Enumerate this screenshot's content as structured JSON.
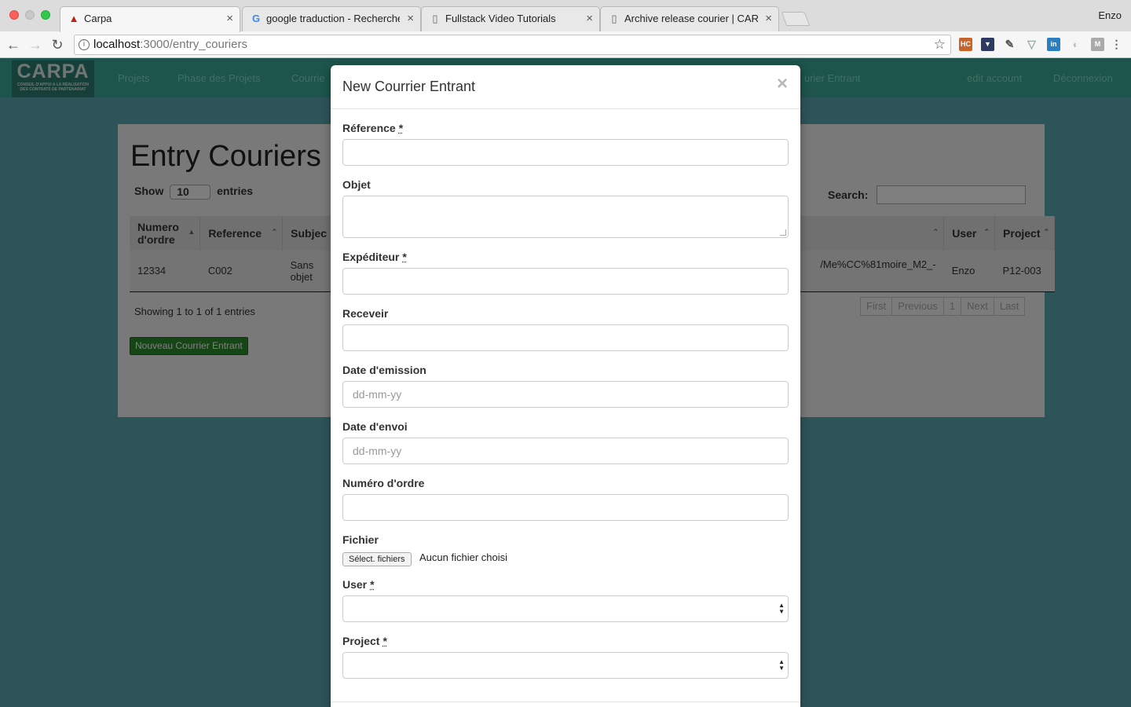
{
  "browser": {
    "tabs": [
      {
        "title": "Carpa",
        "icon": "warning-icon"
      },
      {
        "title": "google traduction - Recherche",
        "icon": "google-icon"
      },
      {
        "title": "Fullstack Video Tutorials",
        "icon": "document-icon"
      },
      {
        "title": "Archive release courier | CARP",
        "icon": "document-icon"
      }
    ],
    "profile_name": "Enzo",
    "url_host": "localhost",
    "url_path": ":3000/entry_couriers"
  },
  "app": {
    "logo_title": "CARPA",
    "logo_subtitle_1": "CONSEIL D'APPUI A LA RÉALISATION",
    "logo_subtitle_2": "DES CONTRATS DE PARTENARIAT",
    "nav": {
      "projets": "Projets",
      "phase": "Phase des Projets",
      "courrier": "Courrie",
      "courrier_entrant": "urier Entrant",
      "edit_account": "edit account",
      "deconnexion": "Déconnexion"
    },
    "page_title": "Entry Couriers",
    "show_label": "Show",
    "entries_label": "entries",
    "entries_value": "10",
    "search_label": "Search:",
    "columns": {
      "numero": "Numero d'ordre",
      "reference": "Reference",
      "subject": "Subjec",
      "user": "User",
      "project": "Project"
    },
    "row": {
      "numero": "12334",
      "reference": "C002",
      "subject": "Sans objet",
      "file": "/Me%CC%81moire_M2_-",
      "user": "Enzo",
      "project": "P12-003"
    },
    "showing_text": "Showing 1 to 1 of 1 entries",
    "pager": {
      "first": "First",
      "previous": "Previous",
      "page": "1",
      "next": "Next",
      "last": "Last"
    },
    "new_button": "Nouveau Courrier Entrant"
  },
  "modal": {
    "title": "New Courrier Entrant",
    "close": "×",
    "required_mark": "*",
    "fields": {
      "reference": {
        "label": "Réference",
        "value": ""
      },
      "objet": {
        "label": "Objet",
        "value": ""
      },
      "expediteur": {
        "label": "Expéditeur",
        "value": ""
      },
      "receveir": {
        "label": "Receveir",
        "value": ""
      },
      "date_emission": {
        "label": "Date d'emission",
        "placeholder": "dd-mm-yy"
      },
      "date_envoi": {
        "label": "Date d'envoi",
        "placeholder": "dd-mm-yy"
      },
      "numero_ordre": {
        "label": "Numéro d'ordre",
        "value": ""
      },
      "fichier": {
        "label": "Fichier",
        "button": "Sélect. fichiers",
        "status": "Aucun fichier choisi"
      },
      "user": {
        "label": "User",
        "value": ""
      },
      "project": {
        "label": "Project",
        "value": ""
      }
    }
  }
}
